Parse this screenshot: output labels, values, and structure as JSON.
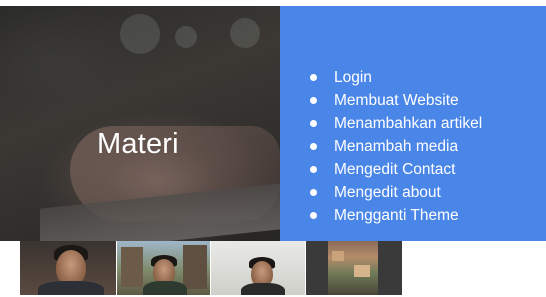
{
  "slide": {
    "title": "Materi",
    "topics": [
      "Login",
      "Membuat Website",
      "Menambahkan artikel",
      "Menambah media",
      "Mengedit Contact",
      "Mengedit about",
      "Mengganti Theme"
    ],
    "panel_color": "#4a86e8"
  },
  "participants": [
    {
      "label": "participant-1"
    },
    {
      "label": "participant-2"
    },
    {
      "label": "participant-3"
    },
    {
      "label": "participant-4"
    }
  ]
}
